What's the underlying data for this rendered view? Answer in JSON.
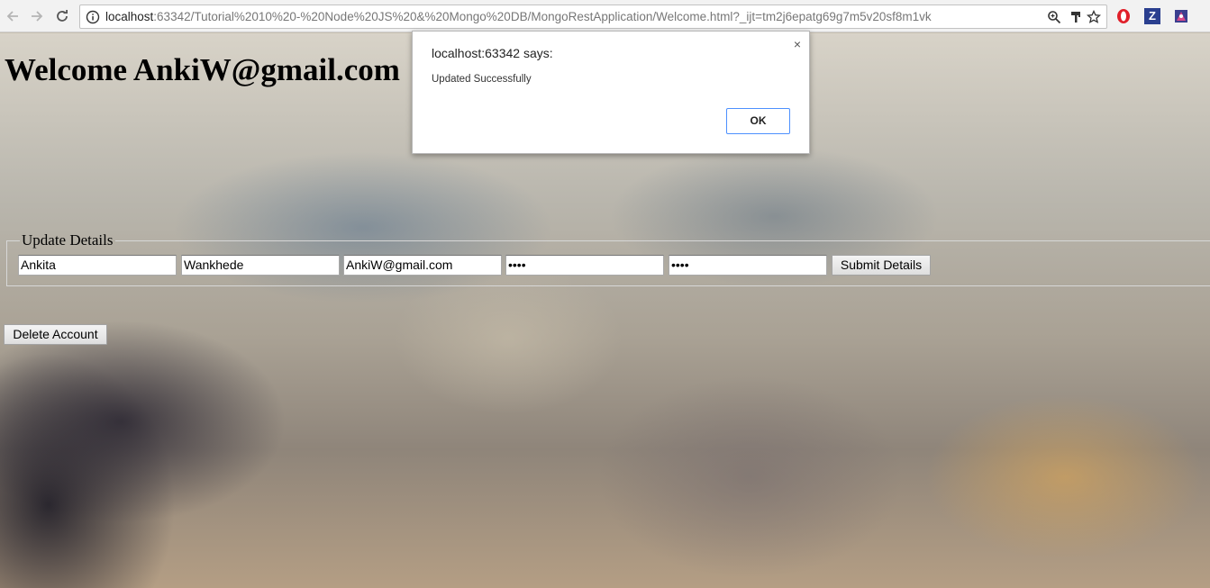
{
  "browser": {
    "url_host": "localhost",
    "url_rest": ":63342/Tutorial%2010%20-%20Node%20JS%20&%20Mongo%20DB/MongoRestApplication/Welcome.html?_ijt=tm2j6epatg69g7m5v20sf8m1vk",
    "icons": {
      "back": "back-arrow-icon",
      "forward": "forward-arrow-icon",
      "reload": "reload-icon",
      "info": "info-icon",
      "zoom": "zoom-icon",
      "paint": "paint-brush-icon",
      "bookmark": "star-icon",
      "opera": "opera-extension-icon",
      "zotero": "zotero-extension-icon",
      "ext3": "extension-icon"
    },
    "extension_letter": "Z"
  },
  "page": {
    "welcome": "Welcome AnkiW@gmail.com",
    "update_legend": "Update Details",
    "first_name_value": "Ankita",
    "last_name_value": "Wankhede",
    "email_value": "AnkiW@gmail.com",
    "password_value": "••••",
    "confirm_password_value": "••••",
    "submit_label": "Submit Details",
    "delete_label": "Delete Account"
  },
  "dialog": {
    "title": "localhost:63342 says:",
    "message": "Updated Successfully",
    "close_glyph": "×",
    "ok_label": "OK"
  },
  "colors": {
    "dialog_ok_border": "#4d90fe",
    "opera_red": "#e0202a",
    "zotero_blue": "#2a3f8f"
  }
}
